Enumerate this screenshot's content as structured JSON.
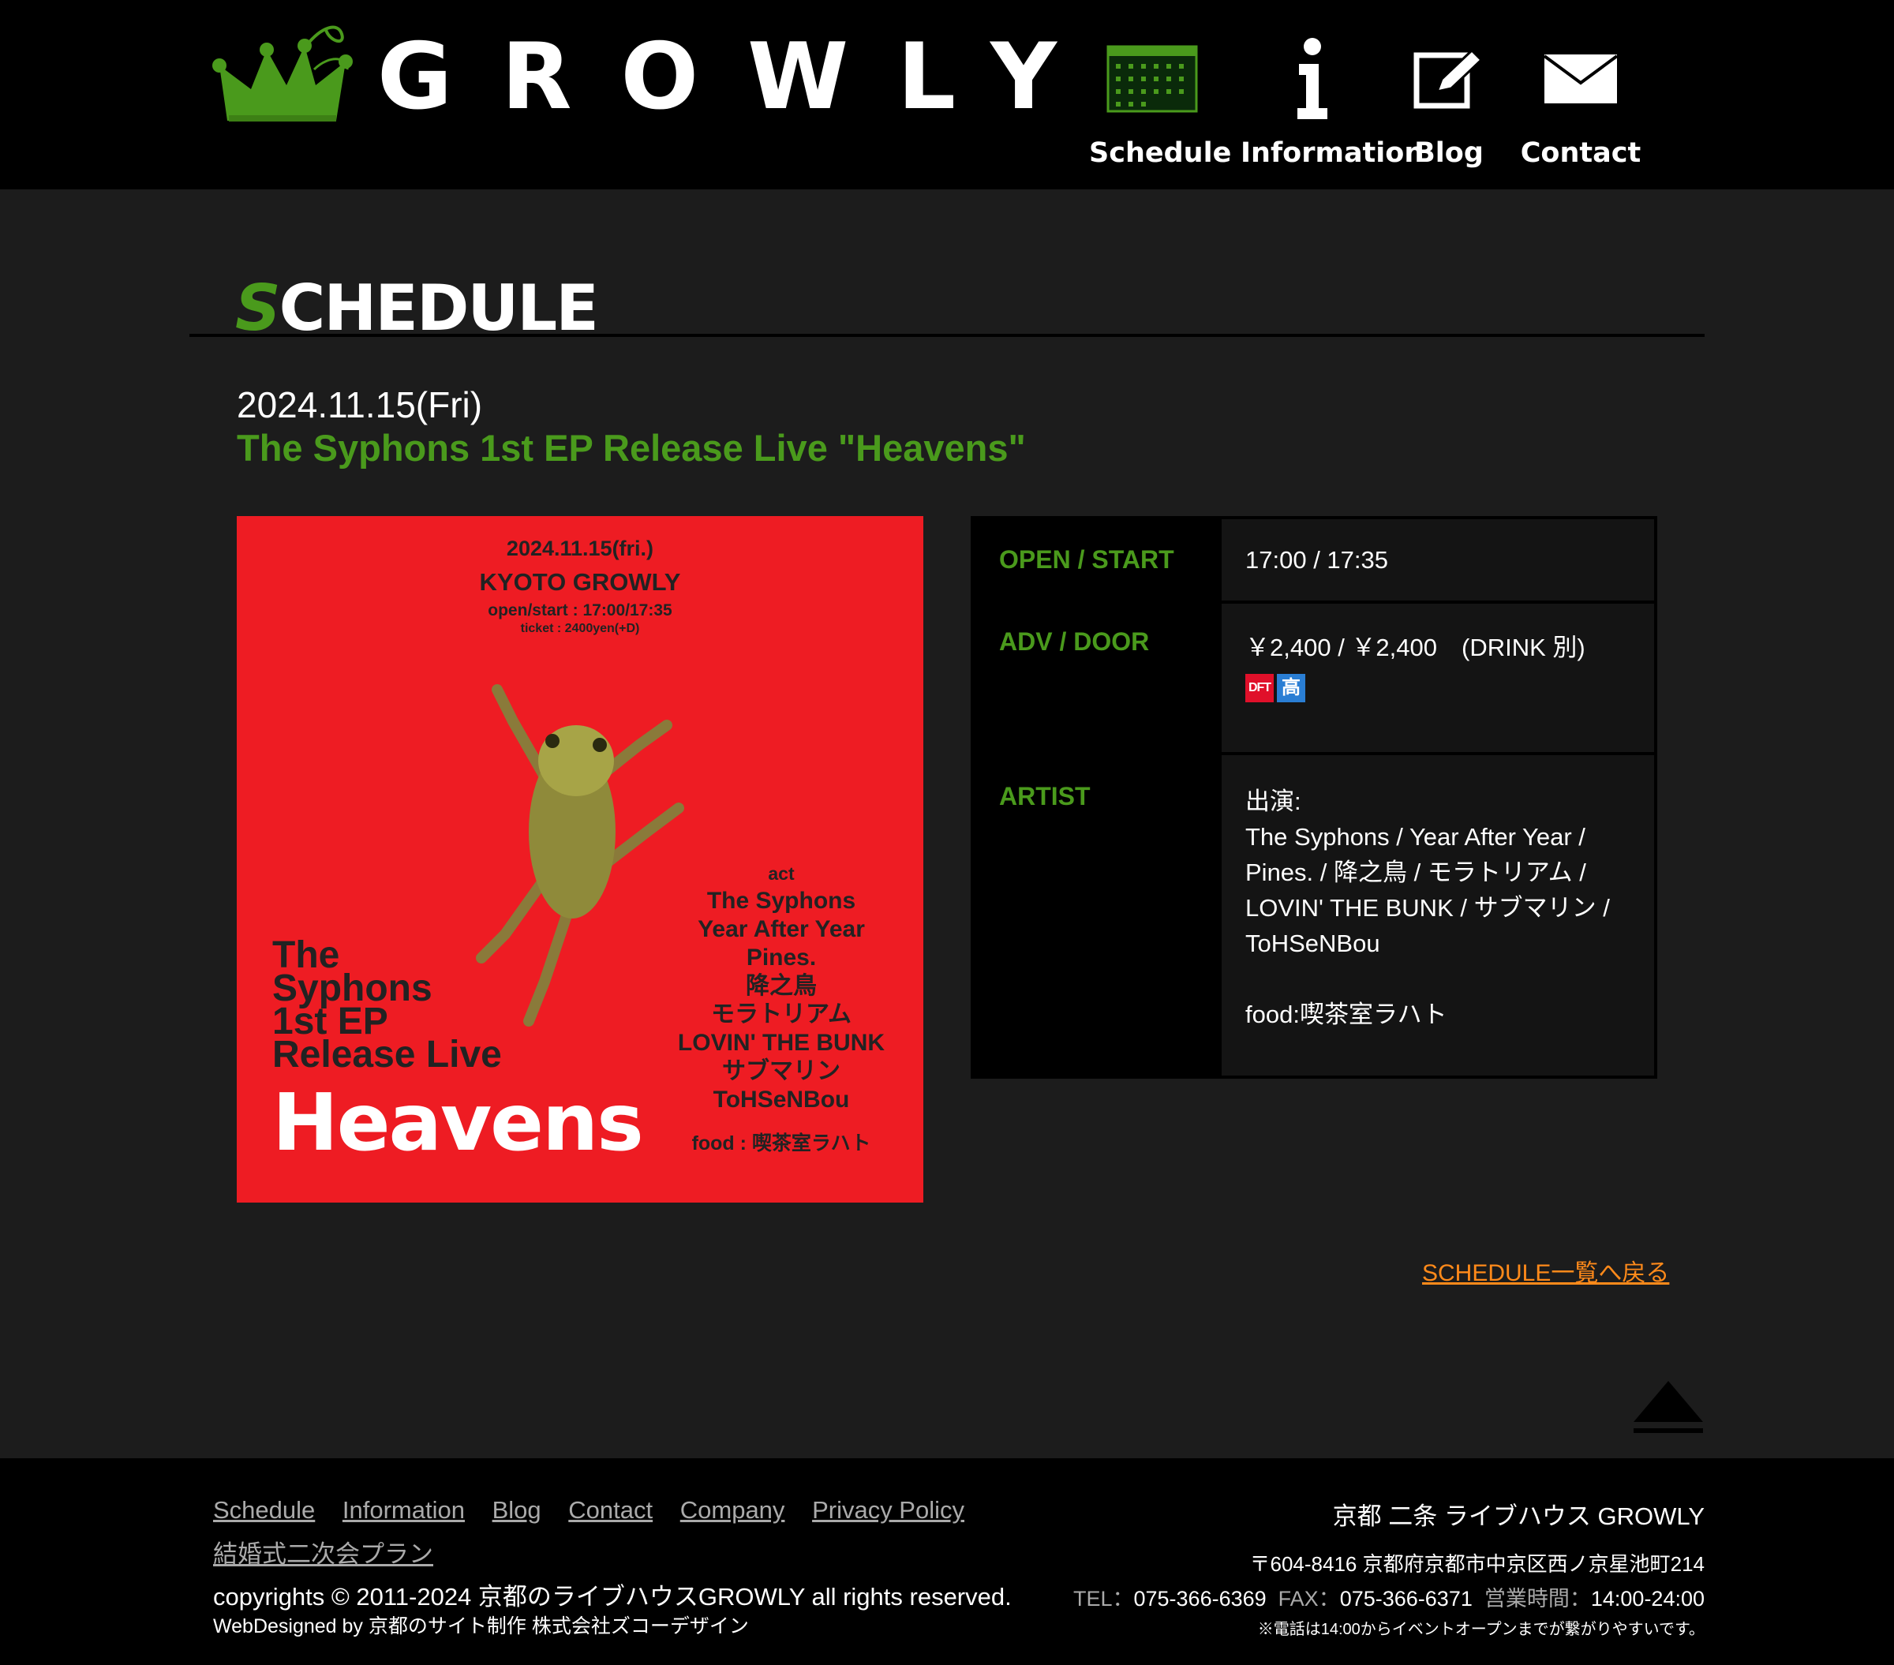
{
  "header": {
    "logo_text": "GROWLY",
    "nav": [
      {
        "label": "Schedule",
        "icon": "calendar-icon"
      },
      {
        "label": "Information",
        "icon": "info-icon"
      },
      {
        "label": "Blog",
        "icon": "pencil-icon"
      },
      {
        "label": "Contact",
        "icon": "mail-icon"
      }
    ]
  },
  "page": {
    "heading_first": "S",
    "heading_rest": "CHEDULE"
  },
  "event": {
    "date": "2024.11.15(Fri)",
    "title": "The Syphons 1st EP Release Live \"Heavens\"",
    "flyer": {
      "date": "2024.11.15(fri.)",
      "venue": "KYOTO GROWLY",
      "open": "open/start : 17:00/17:35",
      "ticket": "ticket : 2400yen(+D)",
      "act_label": "act",
      "artists": [
        "The Syphons",
        "Year After Year",
        "Pines.",
        "降之鳥",
        "モラトリアム",
        "LOVIN' THE BUNK",
        "サブマリン",
        "ToHSeNBou"
      ],
      "food": "food : 喫茶室ラハト",
      "title_lines": [
        "The",
        "Syphons",
        "1st EP",
        "Release Live"
      ],
      "title_big": "Heavens"
    },
    "table": {
      "open_label": "OPEN / START",
      "open_value": "17:00 / 17:35",
      "price_label": "ADV / DOOR",
      "price_value": "￥2,400 / ￥2,400　(DRINK 別)",
      "badges": [
        "DFT",
        "高"
      ],
      "artist_label": "ARTIST",
      "artist_intro": "出演:",
      "artist_lines": [
        "The Syphons / Year After Year /",
        "Pines. / 降之鳥 / モラトリアム /",
        "LOVIN' THE BUNK / サブマリン /",
        "ToHSeNBou"
      ],
      "food": "food:喫茶室ラハト"
    }
  },
  "back_link": "SCHEDULE一覧へ戻る",
  "footer": {
    "links": [
      "Schedule",
      "Information",
      "Blog",
      "Contact",
      "Company",
      "Privacy Policy",
      "結婚式二次会プラン"
    ],
    "copyright": "copyrights © 2011-2024 京都のライブハウスGROWLY all rights reserved.",
    "designer": "WebDesigned by 京都のサイト制作 株式会社ズコーデザイン",
    "venue": "京都 二条 ライブハウス GROWLY",
    "address": "〒604-8416 京都府京都市中京区西ノ京星池町214",
    "tel_label": "TEL：",
    "tel": "075-366-6369",
    "fax_label": "FAX：",
    "fax": "075-366-6371",
    "hours_label": "営業時間：",
    "hours": "14:00-24:00",
    "note": "※電話は14:00からイベントオープンまでが繋がりやすいです。"
  },
  "colors": {
    "accent_green": "#4a9a1c",
    "link_orange": "#ff8a1a",
    "flyer_red": "#ee1c23"
  }
}
